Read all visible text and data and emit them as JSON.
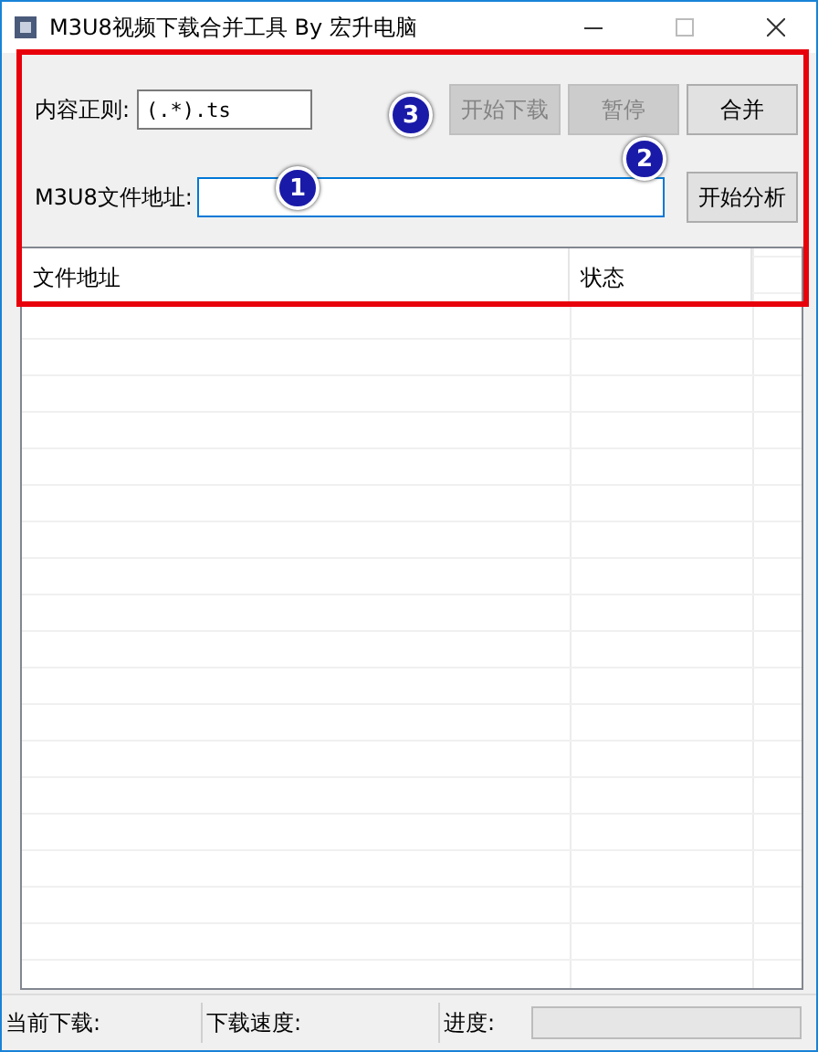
{
  "window": {
    "title": "M3U8视频下载合并工具 By 宏升电脑"
  },
  "regex": {
    "label": "内容正则:",
    "value": "(.*).ts"
  },
  "buttons": [
    {
      "label": "开始下载",
      "disabled": true
    },
    {
      "label": "暂停",
      "disabled": true
    },
    {
      "label": "合并",
      "disabled": false
    }
  ],
  "address": {
    "label": "M3U8文件地址:",
    "button": "开始分析"
  },
  "table": {
    "columns": [
      "文件地址",
      "状态"
    ]
  },
  "status_bar": {
    "current": "当前下载:",
    "speed": "下载速度:",
    "progress_label": "进度:",
    "level": 0
  },
  "annotations": [
    "1",
    "2",
    "3"
  ]
}
